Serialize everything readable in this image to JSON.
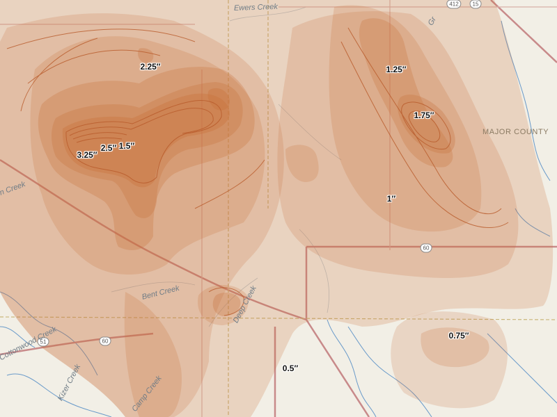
{
  "map": {
    "county_label": "MAJOR COUNTY",
    "highway_shields": [
      "412",
      "15",
      "60",
      "60",
      "51"
    ],
    "creeks": [
      "Ewers Creek",
      "Bent Creek",
      "Deep Creek",
      "Cottonwood Creek",
      "Kizer Creek",
      "Camp Creek",
      "Gr",
      "n Creek"
    ],
    "contour_labels": [
      "2.25″",
      "3.25″",
      "2.5″",
      "1.5″",
      "1.25″",
      "1.75″",
      "1″",
      "0.75″",
      "0.5″"
    ],
    "colors": {
      "base_map": "#f2efe6",
      "contour_fill": "#c8703a",
      "contour_line": "#b85a2a",
      "road": "#c88a8a",
      "water": "#3c7ec0",
      "county_line": "#c9b67a"
    }
  }
}
